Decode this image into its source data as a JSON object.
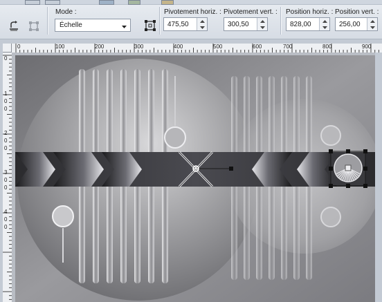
{
  "toolbar": {
    "mode_label": "Mode :",
    "mode_value": "Échelle",
    "pivot_h_label": "Pivotement horiz. :",
    "pivot_h_value": "475,50",
    "pivot_v_label": "Pivotement vert. :",
    "pivot_v_value": "300,50",
    "pos_h_label": "Position horiz. :",
    "pos_h_value": "828,00",
    "pos_v_label": "Position vert. :",
    "pos_v_value": "256,00"
  },
  "ruler_h": [
    "0",
    "100",
    "200",
    "300",
    "400",
    "500",
    "600",
    "700",
    "800",
    "900"
  ],
  "ruler_v": [
    "0",
    "1",
    "0",
    "0",
    "2",
    "0",
    "0",
    "3",
    "0",
    "0",
    "4",
    "0",
    "0"
  ],
  "icons": {
    "left1": "reset-icon",
    "left2": "deform-icon",
    "pivot": "pivot-handle-icon"
  },
  "colors": {
    "accent": "#3d73b8",
    "canvas": "#8e8e92"
  }
}
